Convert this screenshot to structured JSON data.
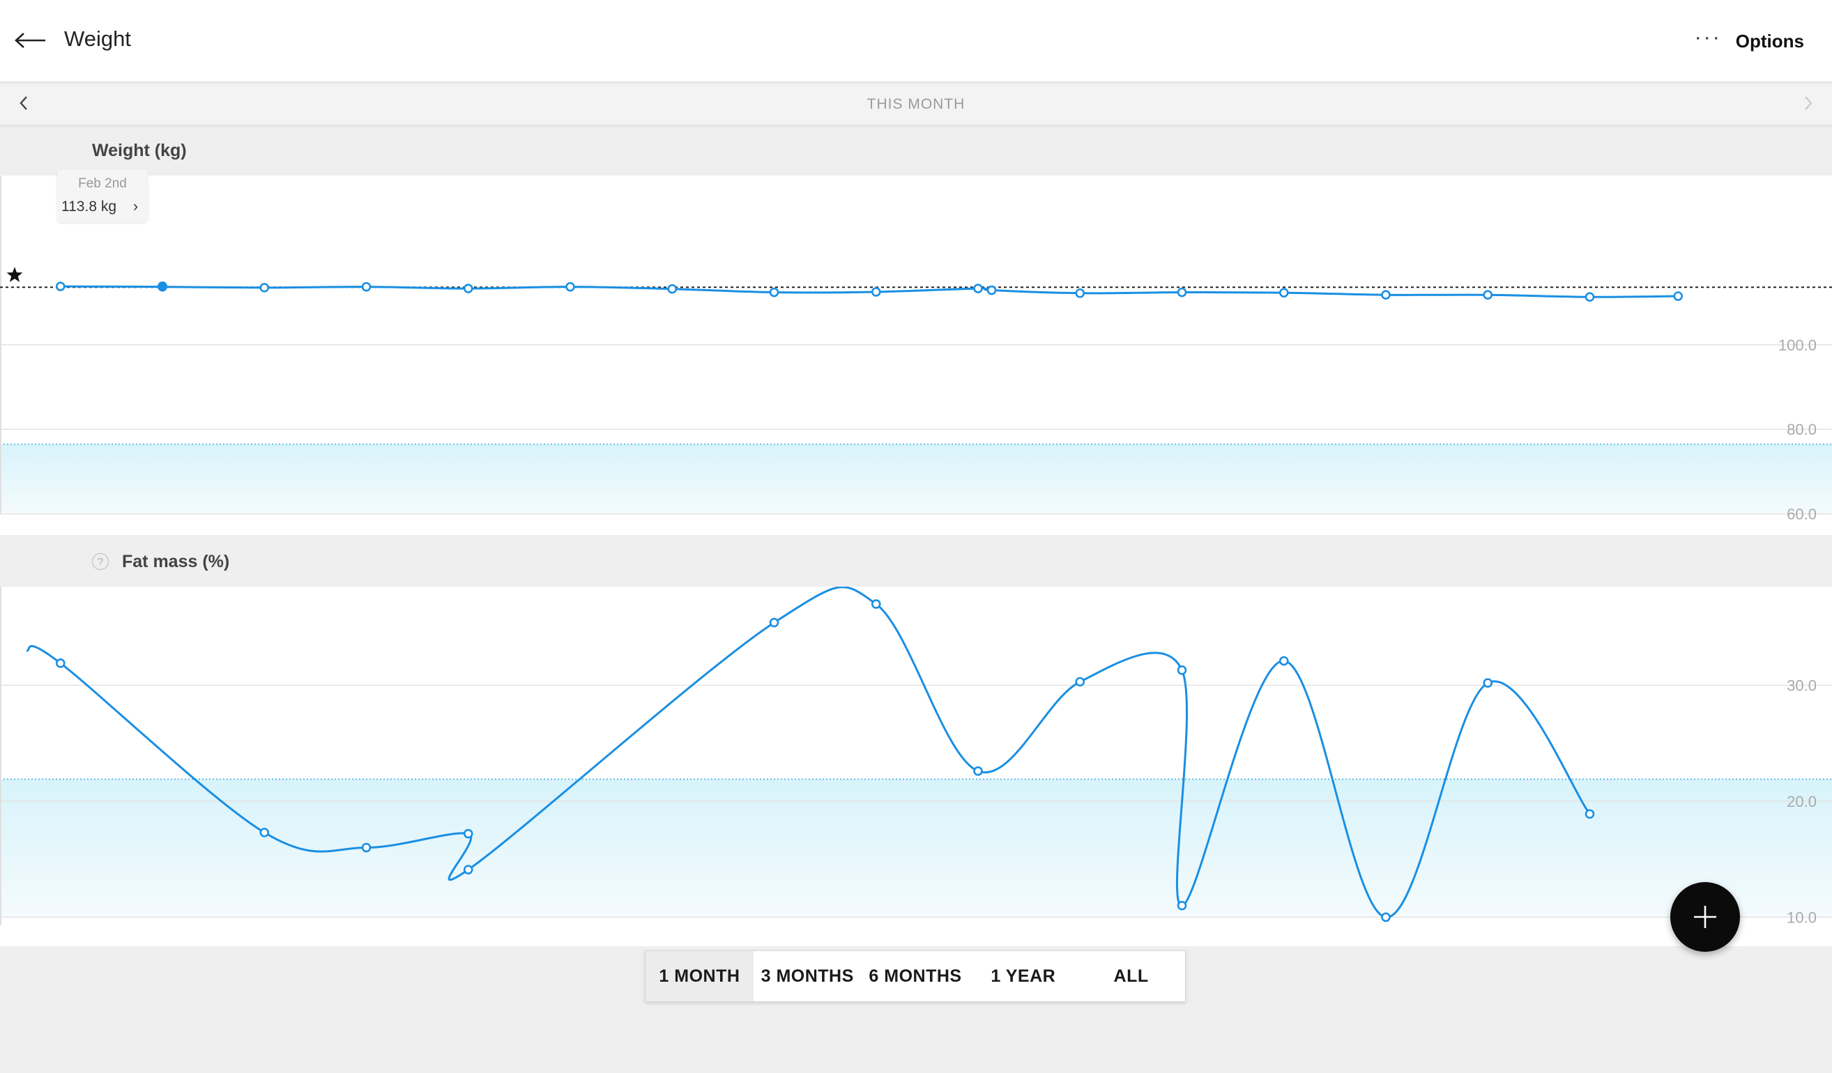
{
  "header": {
    "title": "Weight",
    "options_label": "Options"
  },
  "period": {
    "label": "THIS MONTH"
  },
  "weight_section": {
    "title": "Weight (kg)",
    "tooltip": {
      "date": "Feb 2nd",
      "value": "113.8 kg"
    }
  },
  "fat_section": {
    "title": "Fat mass (%)"
  },
  "range_buttons": [
    {
      "label": "1 MONTH",
      "active": true
    },
    {
      "label": "3 MONTHS",
      "active": false
    },
    {
      "label": "6 MONTHS",
      "active": false
    },
    {
      "label": "1 YEAR",
      "active": false
    },
    {
      "label": "ALL",
      "active": false
    }
  ],
  "colors": {
    "line": "#1a8fe3",
    "band": "#dff5fc",
    "fab": "#0b0b0b"
  },
  "chart_data": [
    {
      "type": "line",
      "title": "Weight (kg)",
      "y_ticks": [
        "100.0",
        "80.0",
        "60.0"
      ],
      "ylim": [
        55,
        140
      ],
      "goal_line": 113.6,
      "healthy_band": [
        60,
        76.5
      ],
      "grid": true,
      "marked_point": {
        "x": 2,
        "y": 113.8
      },
      "series": [
        {
          "x": [
            0.5,
            2,
            3.5,
            5,
            6.5,
            8,
            9.5,
            11,
            12.5,
            14,
            14.2,
            15.5,
            17,
            18.5,
            20,
            21.5,
            23,
            24.3
          ],
          "values": [
            113.8,
            113.7,
            113.5,
            113.7,
            113.3,
            113.7,
            113.2,
            112.4,
            112.5,
            113.3,
            112.9,
            112.2,
            112.4,
            112.3,
            111.8,
            111.8,
            111.3,
            111.5
          ]
        }
      ]
    },
    {
      "type": "line",
      "title": "Fat mass (%)",
      "y_ticks": [
        "30.0",
        "20.0",
        "10.0"
      ],
      "ylim": [
        7.5,
        38.5
      ],
      "goal_line": 21.9,
      "healthy_band": [
        10,
        21.9
      ],
      "grid": true,
      "series": [
        {
          "x": [
            0,
            0.5,
            3.5,
            5,
            6.5,
            6.5,
            11,
            12.5,
            14,
            15.5,
            17,
            17,
            18.5,
            20,
            21.5,
            23
          ],
          "values": [
            33.0,
            31.9,
            17.3,
            16.0,
            17.2,
            14.1,
            35.4,
            37.0,
            22.6,
            30.3,
            31.3,
            11.0,
            32.1,
            10.0,
            30.2,
            18.9
          ]
        }
      ]
    }
  ]
}
